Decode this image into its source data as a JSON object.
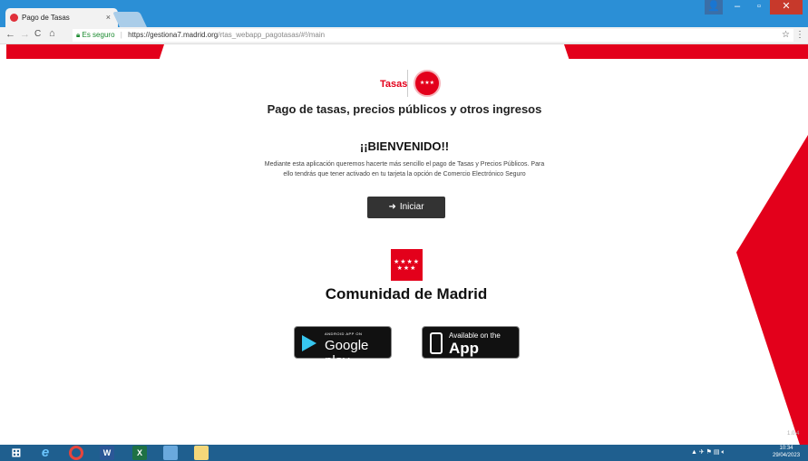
{
  "browser": {
    "tab_title": "Pago de Tasas",
    "tab_close": "×",
    "security_label": "Es seguro",
    "url_host": "https://gestiona7.madrid.org",
    "url_path": "/rtas_webapp_pagotasas/#!/main",
    "nav_back": "←",
    "nav_forward": "→",
    "nav_reload": "C",
    "nav_home": "⌂",
    "bookmark_star": "☆",
    "menu": "⋮"
  },
  "window_controls": {
    "user": "👤",
    "minimize": "–",
    "maximize": "▫",
    "close": "✕"
  },
  "page": {
    "logo_tasas": "Tasas",
    "title": "Pago de tasas, precios públicos y otros ingresos",
    "welcome": "¡¡BIENVENIDO!!",
    "description": "Mediante esta aplicación queremos hacerte más sencillo el pago de Tasas y Precios Públicos. Para ello tendrás que tener activado en tu tarjeta la opción de Comercio Electrónico Seguro",
    "start_button": "Iniciar",
    "flag_stars": "★★★★ ★★★",
    "region_name": "Comunidad de Madrid",
    "google_play_small": "ANDROID APP ON",
    "google_play_big": "Google play",
    "app_store_small": "Available on the",
    "app_store_big": "App Store",
    "version": "1.0.4"
  },
  "taskbar": {
    "clock_time": "10:34",
    "clock_date": "29/04/2023"
  },
  "colors": {
    "brand_red": "#e3001b",
    "button_dark": "#333333",
    "titlebar_blue": "#2b8fd6",
    "taskbar_blue": "#1f5f8f"
  }
}
